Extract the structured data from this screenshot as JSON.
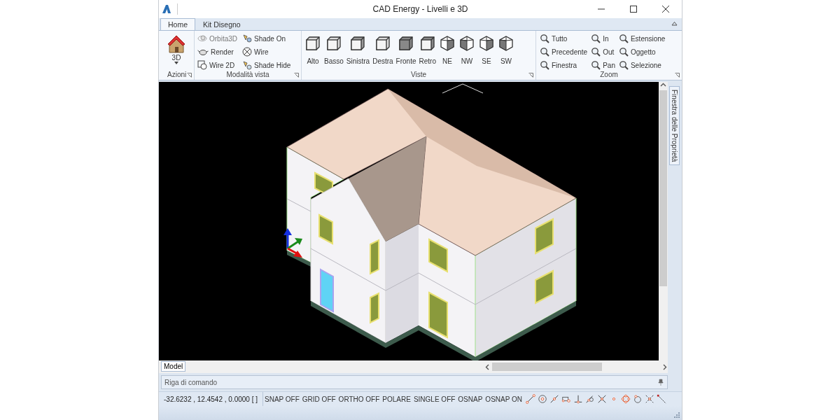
{
  "window": {
    "title": "CAD Energy - Livelli e 3D"
  },
  "tabs": [
    {
      "label": "Home",
      "selected": true
    },
    {
      "label": "Kit Disegno",
      "selected": false
    }
  ],
  "ribbon": {
    "azioni": {
      "title": "Azioni",
      "button": "3D"
    },
    "modalita_vista": {
      "title": "Modalità vista",
      "items": [
        "Orbita3D",
        "Render",
        "Wire 2D",
        "Shade On",
        "Wire",
        "Shade Hide"
      ]
    },
    "viste": {
      "title": "Viste",
      "items": [
        "Alto",
        "Basso",
        "Sinistra",
        "Destra",
        "Fronte",
        "Retro",
        "NE",
        "NW",
        "SE",
        "SW"
      ]
    },
    "zoom": {
      "title": "Zoom",
      "items": [
        "Tutto",
        "Precedente",
        "Finestra",
        "In",
        "Out",
        "Pan",
        "Estensione",
        "Oggetto",
        "Selezione"
      ]
    }
  },
  "side_panel": {
    "title": "Finestra delle Proprietà"
  },
  "layout_tabs": [
    {
      "label": "Model",
      "selected": true
    }
  ],
  "command_line": {
    "placeholder": "Riga di comando"
  },
  "status_bar": {
    "coordinates": "-32.6232 , 12.4542 , 0.0000 [ ]",
    "toggles": [
      "SNAP OFF",
      "GRID OFF",
      "ORTHO OFF",
      "POLARE",
      "SINGLE OFF",
      "OSNAP",
      "OSNAP ON"
    ]
  }
}
